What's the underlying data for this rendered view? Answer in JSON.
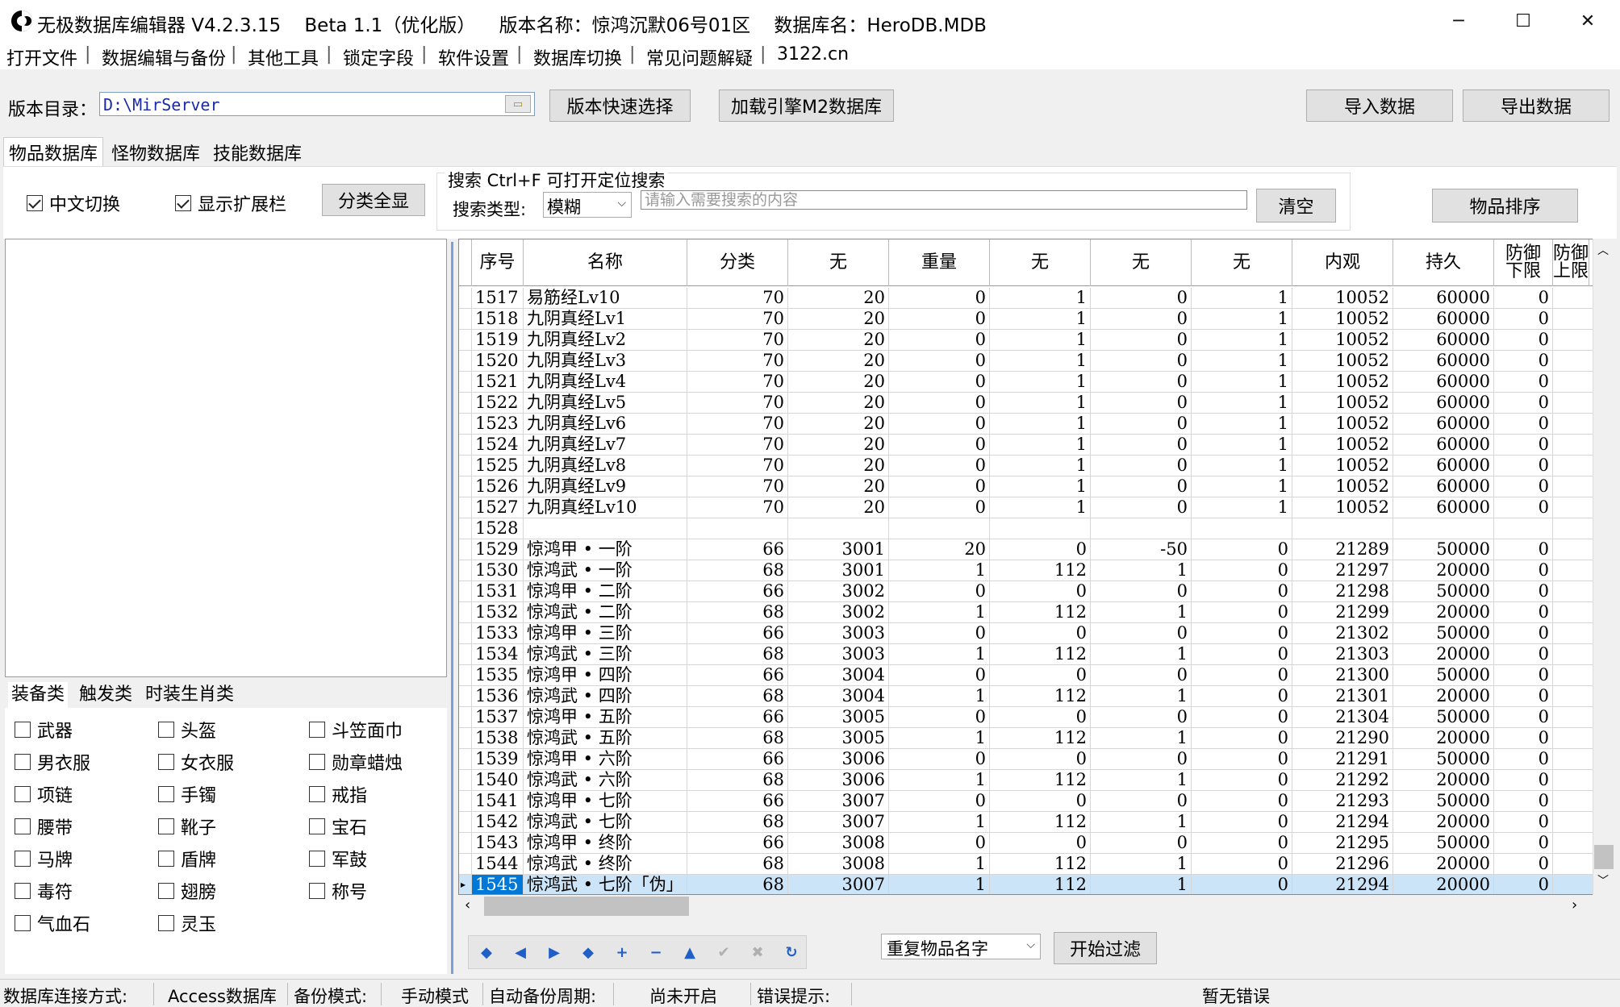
{
  "window": {
    "title": "无极数据库编辑器 V4.2.3.15    Beta 1.1（优化版）    版本名称：惊鸿沉默06号01区    数据库名：HeroDB.MDB",
    "minimize": "─",
    "maximize": "☐",
    "close": "✕"
  },
  "menu": [
    "打开文件",
    "数据编辑与备份",
    "其他工具",
    "锁定字段",
    "软件设置",
    "数据库切换",
    "常见问题解疑",
    "3122.cn"
  ],
  "menu_separator": "|",
  "top": {
    "dir_label": "版本目录：",
    "dir_value": "D:\\MirServer",
    "browse_icon": "folder-icon",
    "quick_select": "版本快速选择",
    "load_m2": "加载引擎M2数据库",
    "import": "导入数据",
    "export": "导出数据"
  },
  "tabs": [
    "物品数据库",
    "怪物数据库",
    "技能数据库"
  ],
  "toolbar": {
    "chinese_toggle": "中文切换",
    "chinese_checked": true,
    "show_ext": "显示扩展栏",
    "show_ext_checked": true,
    "show_all_cats": "分类全显",
    "search_legend": "搜索    Ctrl+F 可打开定位搜索",
    "search_type_label": "搜索类型:",
    "search_type_value": "模糊",
    "search_placeholder": "请输入需要搜索的内容",
    "clear": "清空",
    "sort": "物品排序"
  },
  "category_tabs": [
    "装备类",
    "触发类",
    "时装生肖类"
  ],
  "categories": [
    "武器",
    "头盔",
    "斗笠面巾",
    "男衣服",
    "女衣服",
    "勋章蜡烛",
    "项链",
    "手镯",
    "戒指",
    "腰带",
    "靴子",
    "宝石",
    "马牌",
    "盾牌",
    "军鼓",
    "毒符",
    "翅膀",
    "称号",
    "气血石",
    "灵玉"
  ],
  "grid": {
    "columns": [
      "序号",
      "名称",
      "分类",
      "无",
      "重量",
      "无",
      "无",
      "无",
      "内观",
      "持久",
      "防御\n下限",
      "防御\n上限"
    ],
    "rows": [
      [
        "1517",
        "易筋经Lv10",
        "70",
        "20",
        "0",
        "1",
        "0",
        "1",
        "10052",
        "60000",
        "0"
      ],
      [
        "1518",
        "九阴真经Lv1",
        "70",
        "20",
        "0",
        "1",
        "0",
        "1",
        "10052",
        "60000",
        "0"
      ],
      [
        "1519",
        "九阴真经Lv2",
        "70",
        "20",
        "0",
        "1",
        "0",
        "1",
        "10052",
        "60000",
        "0"
      ],
      [
        "1520",
        "九阴真经Lv3",
        "70",
        "20",
        "0",
        "1",
        "0",
        "1",
        "10052",
        "60000",
        "0"
      ],
      [
        "1521",
        "九阴真经Lv4",
        "70",
        "20",
        "0",
        "1",
        "0",
        "1",
        "10052",
        "60000",
        "0"
      ],
      [
        "1522",
        "九阴真经Lv5",
        "70",
        "20",
        "0",
        "1",
        "0",
        "1",
        "10052",
        "60000",
        "0"
      ],
      [
        "1523",
        "九阴真经Lv6",
        "70",
        "20",
        "0",
        "1",
        "0",
        "1",
        "10052",
        "60000",
        "0"
      ],
      [
        "1524",
        "九阴真经Lv7",
        "70",
        "20",
        "0",
        "1",
        "0",
        "1",
        "10052",
        "60000",
        "0"
      ],
      [
        "1525",
        "九阴真经Lv8",
        "70",
        "20",
        "0",
        "1",
        "0",
        "1",
        "10052",
        "60000",
        "0"
      ],
      [
        "1526",
        "九阴真经Lv9",
        "70",
        "20",
        "0",
        "1",
        "0",
        "1",
        "10052",
        "60000",
        "0"
      ],
      [
        "1527",
        "九阴真经Lv10",
        "70",
        "20",
        "0",
        "1",
        "0",
        "1",
        "10052",
        "60000",
        "0"
      ],
      [
        "1528",
        "",
        "",
        "",
        "",
        "",
        "",
        "",
        "",
        "",
        ""
      ],
      [
        "1529",
        "惊鸿甲 • 一阶",
        "66",
        "3001",
        "20",
        "0",
        "-50",
        "0",
        "21289",
        "50000",
        "0"
      ],
      [
        "1530",
        "惊鸿武 • 一阶",
        "68",
        "3001",
        "1",
        "112",
        "1",
        "0",
        "21297",
        "20000",
        "0"
      ],
      [
        "1531",
        "惊鸿甲 • 二阶",
        "66",
        "3002",
        "0",
        "0",
        "0",
        "0",
        "21298",
        "50000",
        "0"
      ],
      [
        "1532",
        "惊鸿武 • 二阶",
        "68",
        "3002",
        "1",
        "112",
        "1",
        "0",
        "21299",
        "20000",
        "0"
      ],
      [
        "1533",
        "惊鸿甲 • 三阶",
        "66",
        "3003",
        "0",
        "0",
        "0",
        "0",
        "21302",
        "50000",
        "0"
      ],
      [
        "1534",
        "惊鸿武 • 三阶",
        "68",
        "3003",
        "1",
        "112",
        "1",
        "0",
        "21303",
        "20000",
        "0"
      ],
      [
        "1535",
        "惊鸿甲 • 四阶",
        "66",
        "3004",
        "0",
        "0",
        "0",
        "0",
        "21300",
        "50000",
        "0"
      ],
      [
        "1536",
        "惊鸿武 • 四阶",
        "68",
        "3004",
        "1",
        "112",
        "1",
        "0",
        "21301",
        "20000",
        "0"
      ],
      [
        "1537",
        "惊鸿甲 • 五阶",
        "66",
        "3005",
        "0",
        "0",
        "0",
        "0",
        "21304",
        "50000",
        "0"
      ],
      [
        "1538",
        "惊鸿武 • 五阶",
        "68",
        "3005",
        "1",
        "112",
        "1",
        "0",
        "21290",
        "20000",
        "0"
      ],
      [
        "1539",
        "惊鸿甲 • 六阶",
        "66",
        "3006",
        "0",
        "0",
        "0",
        "0",
        "21291",
        "50000",
        "0"
      ],
      [
        "1540",
        "惊鸿武 • 六阶",
        "68",
        "3006",
        "1",
        "112",
        "1",
        "0",
        "21292",
        "20000",
        "0"
      ],
      [
        "1541",
        "惊鸿甲 • 七阶",
        "66",
        "3007",
        "0",
        "0",
        "0",
        "0",
        "21293",
        "50000",
        "0"
      ],
      [
        "1542",
        "惊鸿武 • 七阶",
        "68",
        "3007",
        "1",
        "112",
        "1",
        "0",
        "21294",
        "20000",
        "0"
      ],
      [
        "1543",
        "惊鸿甲 • 终阶",
        "66",
        "3008",
        "0",
        "0",
        "0",
        "0",
        "21295",
        "50000",
        "0"
      ],
      [
        "1544",
        "惊鸿武 • 终阶",
        "68",
        "3008",
        "1",
        "112",
        "1",
        "0",
        "21296",
        "20000",
        "0"
      ],
      [
        "1545",
        "惊鸿武 • 七阶「伪」",
        "68",
        "3007",
        "1",
        "112",
        "1",
        "0",
        "21294",
        "20000",
        "0"
      ]
    ],
    "selected_row": 28
  },
  "nav": {
    "icons": [
      "first-icon",
      "prior-icon",
      "next-icon",
      "last-icon",
      "insert-icon",
      "delete-icon",
      "edit-icon",
      "post-icon",
      "cancel-icon",
      "refresh-icon"
    ],
    "glyphs": [
      "◆",
      "◀",
      "▶",
      "◆",
      "+",
      "−",
      "▲",
      "✔",
      "✖",
      "↻"
    ]
  },
  "filter": {
    "option": "重复物品名字",
    "start": "开始过滤"
  },
  "status": {
    "conn_label": "数据库连接方式:",
    "conn_value": "Access数据库",
    "backup_label": "备份模式:",
    "backup_value": "手动模式",
    "auto_label": "自动备份周期:",
    "auto_value": "尚未开启",
    "err_label": "错误提示:",
    "err_value": "暂无错误"
  },
  "colors": {
    "selection": "#0078d7",
    "selected_row": "#cce4f7",
    "nav_icon": "#1f5fc8",
    "path_text": "#1a2aa8"
  }
}
